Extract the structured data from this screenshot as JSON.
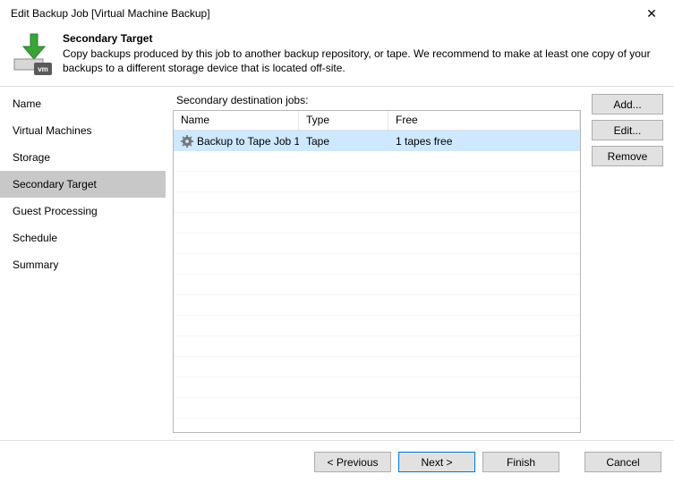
{
  "window": {
    "title": "Edit Backup Job [Virtual Machine Backup]"
  },
  "header": {
    "title": "Secondary Target",
    "description": "Copy backups produced by this job to another backup repository, or tape. We recommend to make at least one copy of your backups to a different storage device that is located off-site."
  },
  "nav": {
    "items": [
      {
        "label": "Name"
      },
      {
        "label": "Virtual Machines"
      },
      {
        "label": "Storage"
      },
      {
        "label": "Secondary Target",
        "selected": true
      },
      {
        "label": "Guest Processing"
      },
      {
        "label": "Schedule"
      },
      {
        "label": "Summary"
      }
    ]
  },
  "content": {
    "label": "Secondary destination jobs:",
    "columns": {
      "name": "Name",
      "type": "Type",
      "free": "Free"
    },
    "rows": [
      {
        "icon": "gear-icon",
        "name": "Backup to Tape Job 1",
        "type": "Tape",
        "free": "1 tapes free",
        "selected": true
      }
    ],
    "buttons": {
      "add": "Add...",
      "edit": "Edit...",
      "remove": "Remove"
    }
  },
  "footer": {
    "previous": "< Previous",
    "next": "Next >",
    "finish": "Finish",
    "cancel": "Cancel"
  }
}
